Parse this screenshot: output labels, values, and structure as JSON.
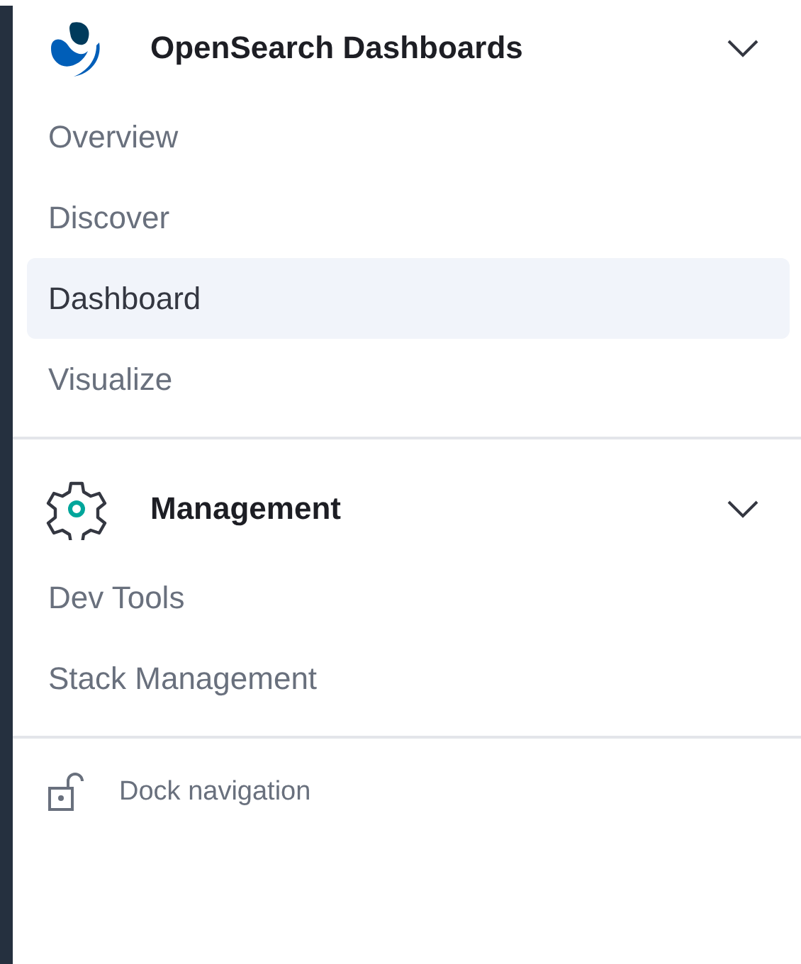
{
  "sections": [
    {
      "kind": "logo",
      "title": "OpenSearch Dashboards",
      "expanded": true,
      "items": [
        {
          "label": "Overview",
          "selected": false
        },
        {
          "label": "Discover",
          "selected": false
        },
        {
          "label": "Dashboard",
          "selected": true
        },
        {
          "label": "Visualize",
          "selected": false
        }
      ]
    },
    {
      "kind": "gear",
      "title": "Management",
      "expanded": true,
      "items": [
        {
          "label": "Dev Tools",
          "selected": false
        },
        {
          "label": "Stack Management",
          "selected": false
        }
      ]
    }
  ],
  "dock": {
    "label": "Dock navigation",
    "docked": false
  }
}
